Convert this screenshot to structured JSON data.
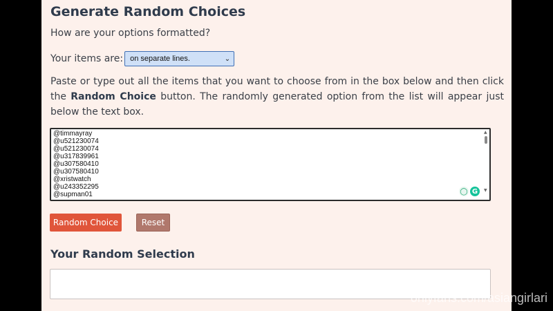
{
  "page": {
    "title": "Generate Random Choices",
    "question": "How are your options formatted?",
    "items_label": "Your items are:",
    "items_select_value": "on separate lines.",
    "instructions_before": "Paste or type out all the items that you want to choose from in the box below and then click the ",
    "instructions_bold": "Random Choice",
    "instructions_after": " button. The randomly generated option from the list will appear just below the text box.",
    "items_list": [
      "@timmayray",
      "@u521230074",
      "@u521230074",
      "@u317839961",
      "@u307580410",
      "@u307580410",
      "@xristwatch",
      "@u243352295",
      "@supman01"
    ],
    "random_button": "Random Choice",
    "reset_button": "Reset",
    "selection_heading": "Your Random Selection",
    "result_value": ""
  },
  "textarea_icons": [
    "lightbulb-icon",
    "grammarly-icon"
  ],
  "colors": {
    "panel_bg": "#fdf1ec",
    "random_button_bg": "#e0553a",
    "reset_button_bg": "#b0786c",
    "select_bg": "#cfe0f7"
  },
  "watermark": "onlyfans.com/asiangirlari"
}
